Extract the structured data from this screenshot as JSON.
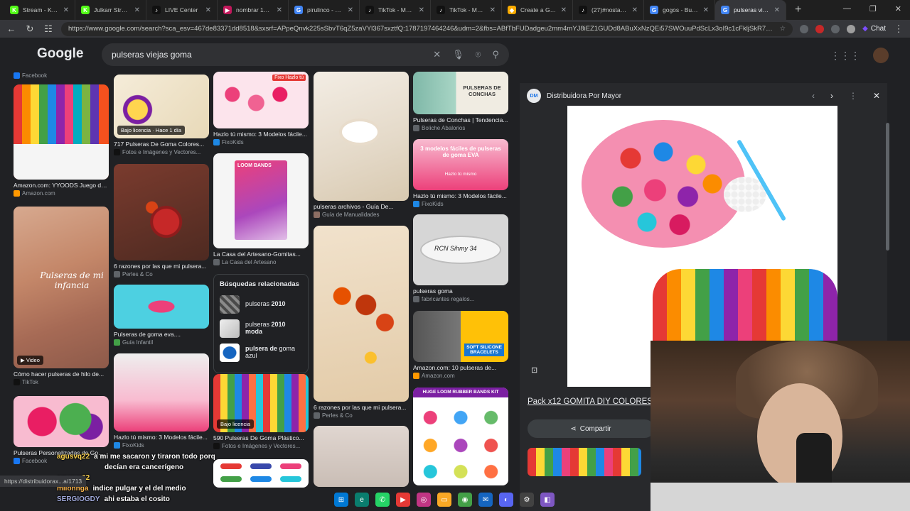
{
  "tabs": [
    {
      "label": "Stream - Kick Da",
      "color": "#53fc18",
      "glyph": "K"
    },
    {
      "label": "Julkarr Stream - V",
      "color": "#53fc18",
      "glyph": "K"
    },
    {
      "label": "LIVE Center",
      "color": "#111111",
      "glyph": "♪"
    },
    {
      "label": "nombrar 100 mu",
      "color": "#c2185b",
      "glyph": "▶"
    },
    {
      "label": "pirulinco - Busca",
      "color": "#4285f4",
      "glyph": "G"
    },
    {
      "label": "TikTok - Make Yo",
      "color": "#111111",
      "glyph": "♪"
    },
    {
      "label": "TikTok - Make Yo",
      "color": "#111111",
      "glyph": "♪"
    },
    {
      "label": "Create a Galletita",
      "color": "#f9ab00",
      "glyph": "◆"
    },
    {
      "label": "(27)#nostalgia #",
      "color": "#111111",
      "glyph": "♪"
    },
    {
      "label": "gogos - Buscar c",
      "color": "#4285f4",
      "glyph": "G"
    },
    {
      "label": "pulseras viejas go",
      "color": "#4285f4",
      "glyph": "G"
    }
  ],
  "address_bar": {
    "url": "https://www.google.com/search?sca_esv=467de83371dd8518&sxsrf=APpeQnvk225sSbvT6qZ5zaVYl367sxztfQ:1787197464246&udm=2&fbs=ABfTbFUDadgeu2mm4mYJ8iEZ1GUDd8ABuXxNzQEi57SWOuuPdScLx3oI9c1cFkljSkR7a..."
  },
  "chat_button": "Chat",
  "google": {
    "logo": "Google",
    "query": "pulseras viejas goma"
  },
  "results": {
    "col1": [
      {
        "caption": "",
        "source": "Facebook",
        "badge": ""
      },
      {
        "caption": "Amazon.com: YYOODS Juego de...",
        "source": "Amazon.com",
        "badge": ""
      },
      {
        "caption": "Cómo hacer pulseras de hilo de...",
        "source": "TikTok",
        "badge": "▶ Video"
      },
      {
        "caption": "Pulseras Personalizadas de Goma...",
        "source": "Facebook",
        "badge": ""
      }
    ],
    "col2": [
      {
        "caption": "717 Pulseras De Goma Colores...",
        "source": "Fotos e Imágenes y Vectores...",
        "badge": "Bajo licencia · Hace 1 día"
      },
      {
        "caption": "6 razones por las que mi pulsera...",
        "source": "Perles & Co",
        "badge": ""
      },
      {
        "caption": "Pulseras de goma eva....",
        "source": "Guía Infantil",
        "badge": ""
      },
      {
        "caption": "Hazlo tú mismo: 3 Modelos fácile...",
        "source": "FixoKids",
        "badge": ""
      }
    ],
    "col3": [
      {
        "caption": "Hazlo tú mismo: 3 Modelos fácile...",
        "source": "FixoKids",
        "badge": ""
      },
      {
        "caption": "La Casa del Artesano-Gomitas...",
        "source": "La Casa del Artesano",
        "badge": ""
      },
      {
        "caption": "590 Pulseras De Goma Plástico...",
        "source": "Fotos e Imágenes y Vectores...",
        "badge": "Bajo licencia"
      }
    ],
    "col4": [
      {
        "caption": "pulseras archivos - Guía De...",
        "source": "Guía de Manualidades",
        "badge": ""
      },
      {
        "caption": "6 razones por las que mi pulsera...",
        "source": "Perles & Co",
        "badge": ""
      }
    ],
    "col5": [
      {
        "caption": "Pulseras de Conchas | Tendencia...",
        "source": "Boliche Abalorios",
        "badge": ""
      },
      {
        "caption": "Hazlo tú mismo: 3 Modelos fácile...",
        "source": "FixoKids",
        "badge": ""
      },
      {
        "caption": "pulseras goma",
        "source": "fabricantes regalos...",
        "badge": ""
      },
      {
        "caption": "Amazon.com: 10 pulseras de...",
        "source": "Amazon.com",
        "badge": ""
      }
    ]
  },
  "thumb_text": {
    "fixo": "Fixo Hazlo tú",
    "conchas": "PULSERAS DE CONCHAS",
    "modelos": "3 modelos fáciles de pulseras de goma EVA",
    "modelos_sub": "Hazlo tú mismo",
    "band": "RCN Sihmy 34",
    "silicone": "SOFT SILICONE BRACELETS",
    "loomkit": "HUGE LOOM RUBBER BANDS KIT",
    "infancia": "Pulseras de mi infancia",
    "loombands": "LOOM BANDS"
  },
  "related": {
    "title": "Búsquedas relacionadas",
    "items": [
      {
        "prefix": "pulseras ",
        "bold": "2010",
        "suffix": ""
      },
      {
        "prefix": "pulseras ",
        "bold": "2010 moda",
        "suffix": ""
      },
      {
        "prefix": "",
        "bold": "pulsera de",
        "suffix": " goma azul"
      }
    ]
  },
  "panel": {
    "logo": "DM",
    "source": "Distribuidora Por Mayor",
    "title": "Pack x12 GOMITA DIY COLORES",
    "share": "Compartir"
  },
  "chat": [
    {
      "user": "agusvq22",
      "msg": "a mi me sacaron y tiraron todo porq"
    },
    {
      "user": "",
      "msg": "decían era cancerígeno"
    },
    {
      "user": "agusvq22",
      "msg": ""
    },
    {
      "user": "milonnga",
      "msg": "indice pulgar y el del medio"
    },
    {
      "user": "SERGIOGDY",
      "msg": "ahi estaba el cosito"
    }
  ],
  "status_url": "https://distribuidorax...a/1713"
}
